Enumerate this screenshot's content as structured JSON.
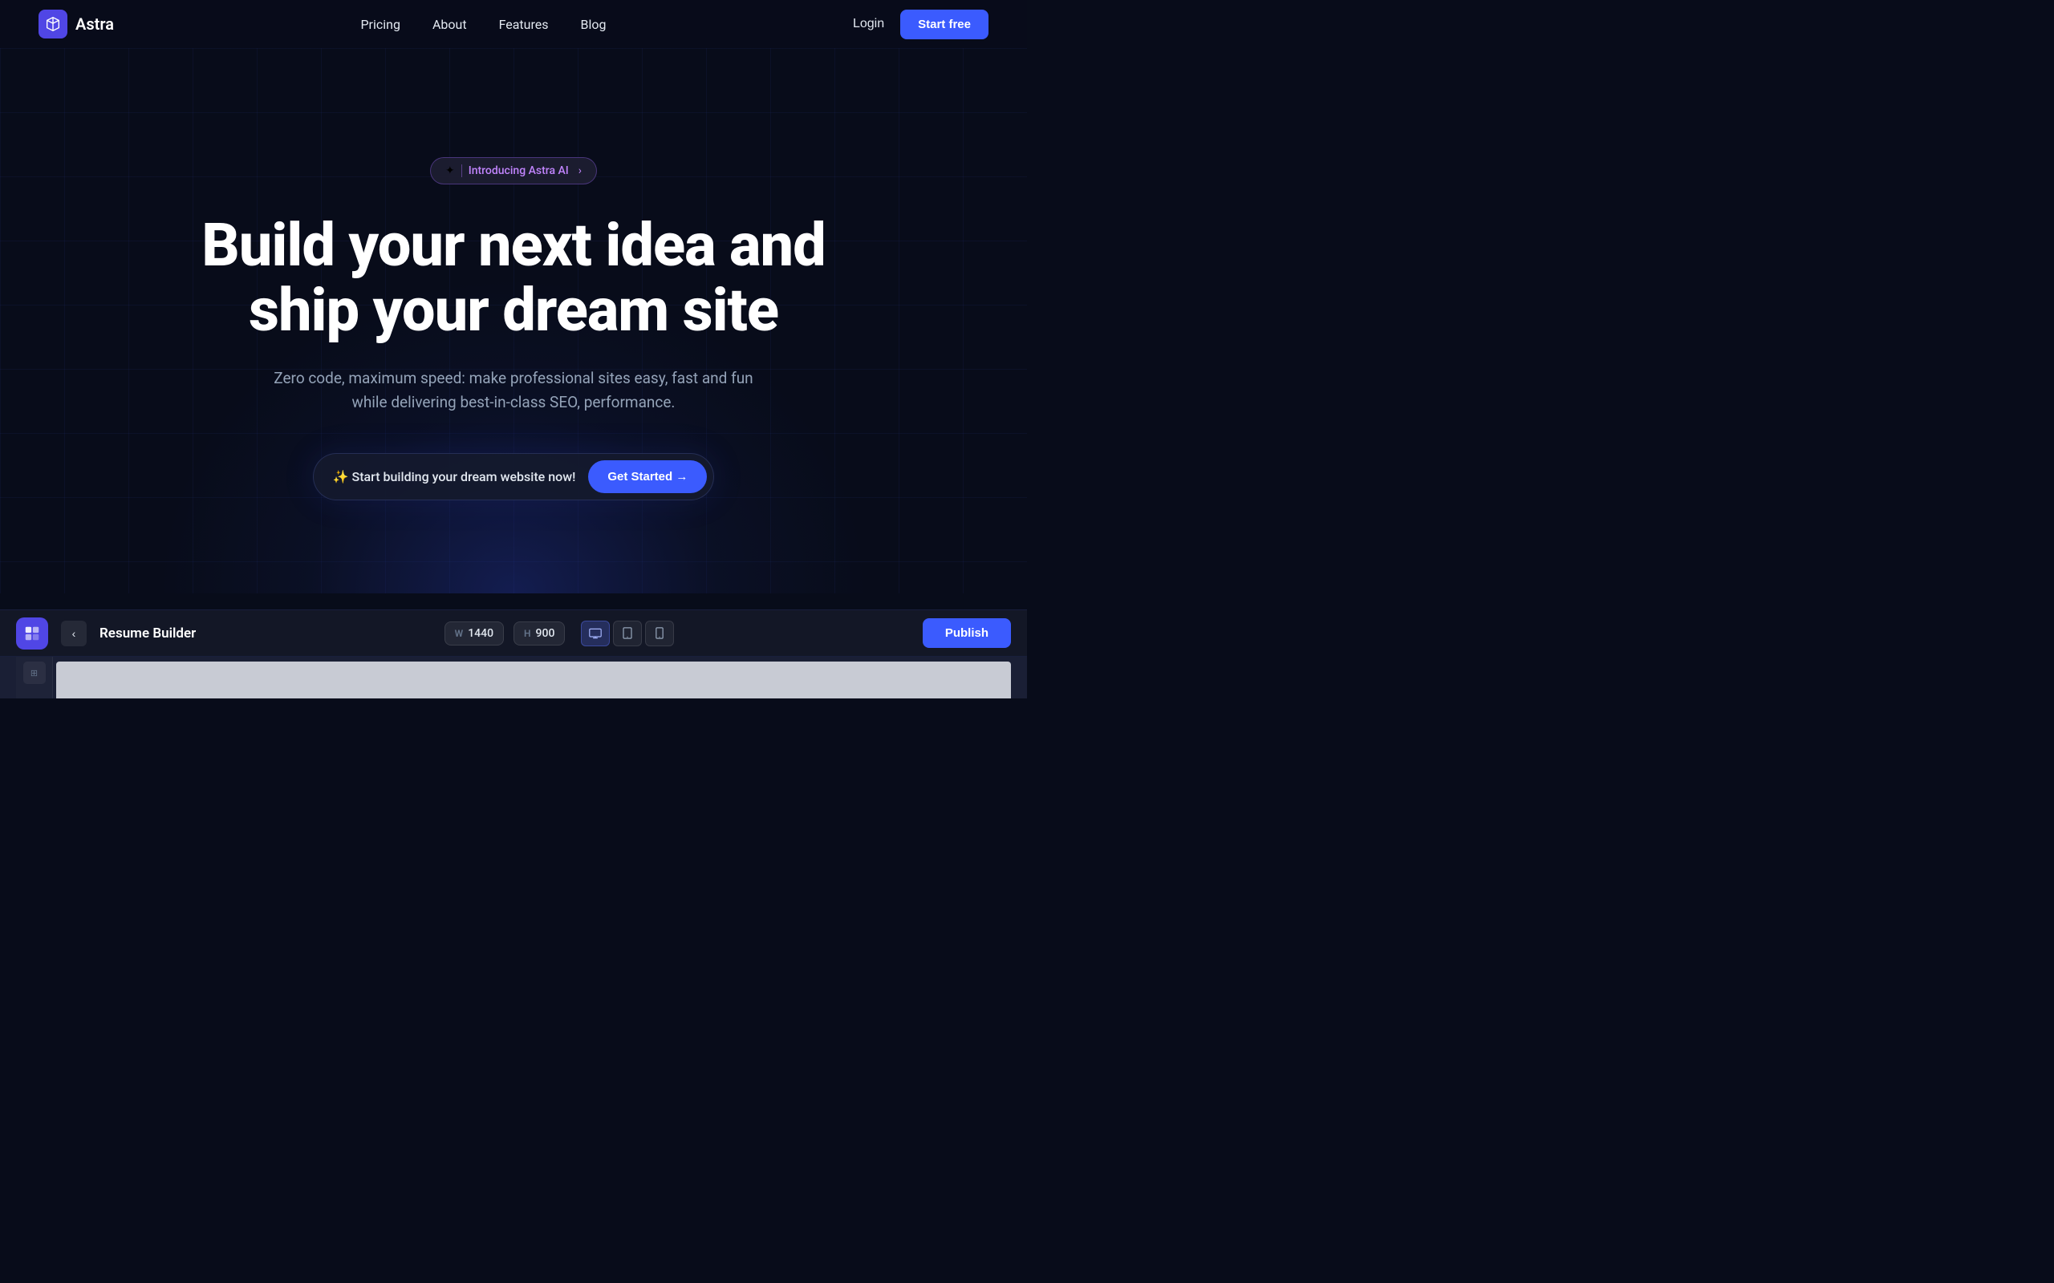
{
  "brand": {
    "logo_text": "Astra",
    "logo_bg": "#5046e5"
  },
  "navbar": {
    "links": [
      {
        "label": "Pricing",
        "id": "pricing"
      },
      {
        "label": "About",
        "id": "about"
      },
      {
        "label": "Features",
        "id": "features"
      },
      {
        "label": "Blog",
        "id": "blog"
      }
    ],
    "login_label": "Login",
    "start_free_label": "Start free"
  },
  "hero": {
    "badge_text": "Introducing Astra AI",
    "title_line1": "Build your next idea and",
    "title_line2": "ship your dream site",
    "subtitle": "Zero code, maximum speed: make professional sites easy, fast and fun while delivering best-in-class SEO, performance.",
    "cta_text": "✨ Start building your dream website now!",
    "cta_button": "Get Started →"
  },
  "builder": {
    "project_name": "Resume Builder",
    "width_label": "W",
    "width_value": "1440",
    "height_label": "H",
    "height_value": "900",
    "publish_label": "Publish",
    "devices": [
      {
        "id": "desktop",
        "active": true
      },
      {
        "id": "tablet",
        "active": false
      },
      {
        "id": "mobile",
        "active": false
      }
    ]
  }
}
